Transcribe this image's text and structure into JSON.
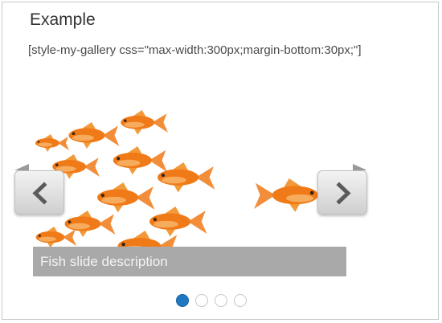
{
  "heading": "Example",
  "shortcode": "[style-my-gallery css=\"max-width:300px;margin-bottom:30px;\"]",
  "slider": {
    "caption": "Fish slide description",
    "image_subject": "goldfish school",
    "prev_icon": "chevron-left-icon",
    "next_icon": "chevron-right-icon",
    "active_slide": 1,
    "slide_count": 4
  },
  "colors": {
    "active_dot": "#1f78c1",
    "caption_bg": "#a9a9a9",
    "fish": "#f07a18"
  }
}
